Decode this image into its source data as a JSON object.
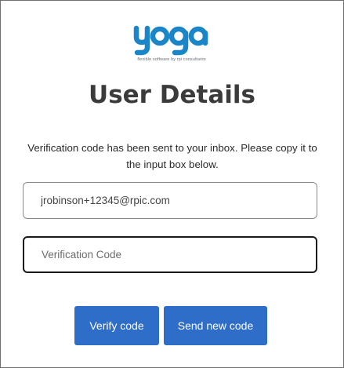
{
  "brand": {
    "logo_text": "yoga",
    "tagline": "flexible software by rpi consultants",
    "color": "#1a86c8"
  },
  "page": {
    "title": "User Details",
    "message": "Verification code has been sent to your inbox. Please copy it to the input box below."
  },
  "form": {
    "email_value": "jrobinson+12345@rpic.com",
    "code_value": "",
    "code_placeholder": "Verification Code"
  },
  "buttons": {
    "verify_label": "Verify code",
    "resend_label": "Send new code",
    "color": "#2f6ec8"
  }
}
